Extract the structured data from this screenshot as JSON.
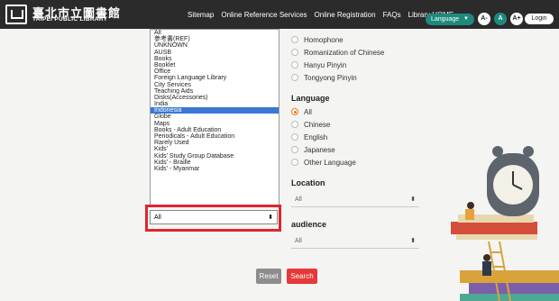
{
  "header": {
    "logo_zh": "臺北市立圖書館",
    "logo_en": "TAIPEI PUBLIC LIBRARY",
    "nav": [
      "Sitemap",
      "Online Reference Services",
      "Online Registration",
      "FAQs",
      "Library HOME"
    ],
    "language_label": "Language",
    "font_sizes": [
      "A-",
      "A",
      "A+"
    ],
    "login_label": "Login"
  },
  "listbox": {
    "options": [
      "All",
      "參考書(REF)",
      "UNKNOWN",
      "AUSB",
      "Books",
      "Booklet",
      "Office",
      "Foreign Language Library",
      "City Services",
      "Teaching Aids",
      "Disks(Accessories)",
      "India",
      "Indonesia",
      "Globe",
      "Maps",
      "Books - Adult Education",
      "Periodicals - Adult Education",
      "Rarely Used",
      "Kids'",
      "Kids' Study Group Database",
      "Kids' - Braille",
      "Kids' - Myanmar"
    ],
    "selected": "Indonesia"
  },
  "collection_select": {
    "value": "All"
  },
  "romanization": {
    "options": [
      "Homophone",
      "Romanization of Chinese",
      "Hanyu Pinyin",
      "Tongyong Pinyin"
    ]
  },
  "language": {
    "title": "Language",
    "options": [
      "All",
      "Chinese",
      "English",
      "Japanese",
      "Other Language"
    ],
    "checked": "All"
  },
  "location": {
    "title": "Location",
    "value": "All"
  },
  "audience": {
    "title": "audience",
    "value": "All"
  },
  "buttons": {
    "reset": "Reset",
    "search": "Search"
  },
  "colors": {
    "header": "#2b2b2b",
    "accent": "#1e8a7e",
    "search": "#e6393a",
    "highlight": "#e0242f",
    "selected_option": "#3a78d4"
  }
}
